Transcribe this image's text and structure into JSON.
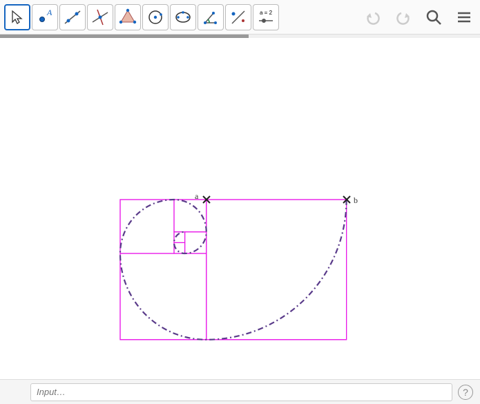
{
  "toolbar": {
    "slider_label": "a = 2",
    "tools": [
      "move",
      "point",
      "line",
      "perpendicular",
      "polygon",
      "circle",
      "ellipse",
      "angle",
      "reflect",
      "slider"
    ]
  },
  "controls": {
    "undo": "Undo",
    "redo": "Redo",
    "search": "Search",
    "menu": "Menu",
    "style_panel": "Style Panel"
  },
  "canvas": {
    "points": {
      "a": "a",
      "b": "b"
    },
    "fibonacci_squares": [
      1,
      1,
      2,
      3,
      5,
      8,
      13
    ],
    "rect_color": "#e815e8",
    "spiral_color": "#5a3b8a"
  },
  "input": {
    "placeholder": "Input…",
    "help": "?"
  }
}
